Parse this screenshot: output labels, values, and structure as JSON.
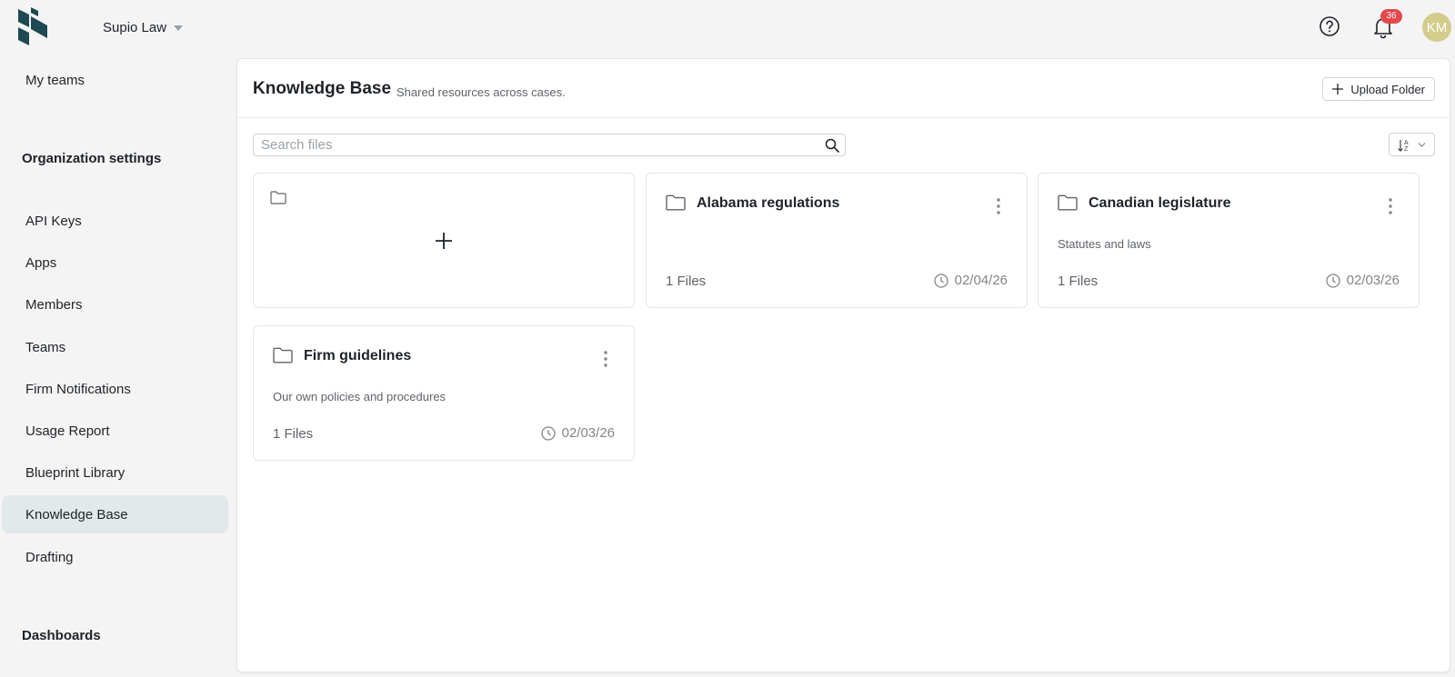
{
  "header": {
    "org_name": "Supio Law",
    "notification_count": "36",
    "avatar_initials": "KM",
    "icons": [
      "logo",
      "chevron-down-icon",
      "help-icon",
      "bell-icon"
    ]
  },
  "sidebar": {
    "top_item": "My teams",
    "org_heading": "Organization settings",
    "items": [
      {
        "label": "API Keys"
      },
      {
        "label": "Apps"
      },
      {
        "label": "Members"
      },
      {
        "label": "Teams"
      },
      {
        "label": "Firm Notifications"
      },
      {
        "label": "Usage Report"
      },
      {
        "label": "Blueprint Library"
      },
      {
        "label": "Knowledge Base",
        "active": true
      },
      {
        "label": "Drafting"
      }
    ],
    "dashboards_heading": "Dashboards"
  },
  "main": {
    "title": "Knowledge Base",
    "subtitle": "Shared resources across cases.",
    "upload_label": "Upload Folder",
    "search_placeholder": "Search files",
    "folders": [
      {
        "name": "Alabama regulations",
        "description": "",
        "files": "1 Files",
        "date": "02/04/26"
      },
      {
        "name": "Canadian legislature",
        "description": "Statutes and laws",
        "files": "1 Files",
        "date": "02/03/26"
      },
      {
        "name": "Firm guidelines",
        "description": "Our own policies and procedures",
        "files": "1 Files",
        "date": "02/03/26"
      }
    ]
  },
  "colors": {
    "accent": "#1d4a52",
    "active_bg": "#e1e9eb",
    "badge": "#e5484d",
    "avatar": "#d3cc8a"
  }
}
